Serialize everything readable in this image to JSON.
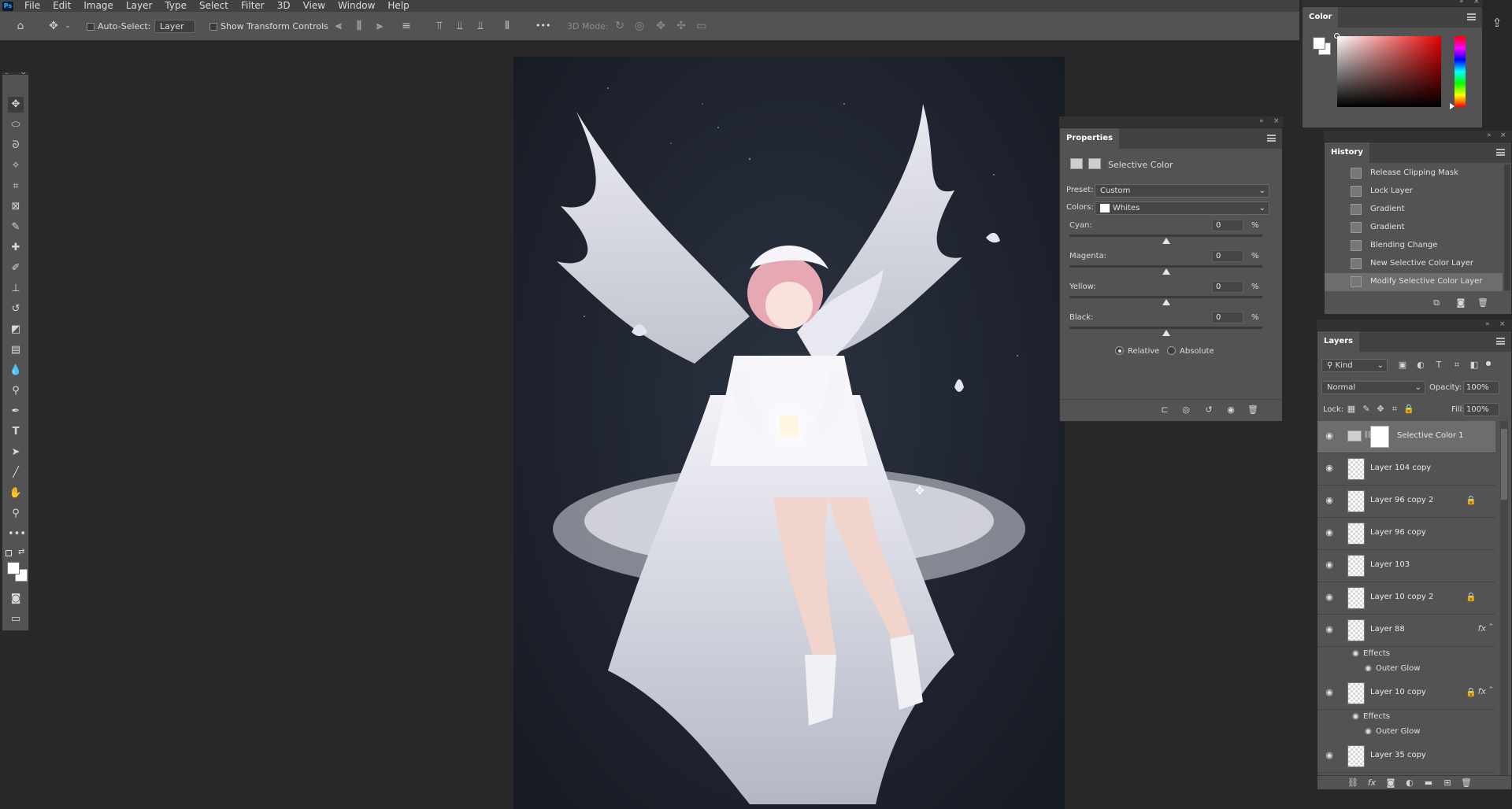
{
  "app": {
    "logo": "Ps"
  },
  "menu": [
    "File",
    "Edit",
    "Image",
    "Layer",
    "Type",
    "Select",
    "Filter",
    "3D",
    "View",
    "Window",
    "Help"
  ],
  "options_bar": {
    "auto_select_label": "Auto-Select:",
    "auto_select_value": "Layer",
    "show_transform_label": "Show Transform Controls",
    "mode_3d_label": "3D Mode:",
    "more_label": "•••"
  },
  "tools": [
    "move-tool",
    "marquee-tool",
    "lasso-tool",
    "magic-wand-tool",
    "crop-tool",
    "frame-tool",
    "eyedropper-tool",
    "healing-brush-tool",
    "brush-tool",
    "clone-stamp-tool",
    "history-brush-tool",
    "eraser-tool",
    "gradient-tool",
    "blur-tool",
    "dodge-tool",
    "pen-tool",
    "type-tool",
    "path-selection-tool",
    "line-tool",
    "hand-tool",
    "zoom-tool"
  ],
  "toolbar_more": "•••",
  "color_panel": {
    "tab": "Color",
    "foreground": "#ffffff",
    "background": "#ffffff"
  },
  "properties": {
    "tab": "Properties",
    "adjustment_name": "Selective Color",
    "preset_label": "Preset:",
    "preset_value": "Custom",
    "colors_label": "Colors:",
    "colors_value": "Whites",
    "sliders": [
      {
        "label": "Cyan:",
        "value": "0",
        "unit": "%",
        "level": 0.5
      },
      {
        "label": "Magenta:",
        "value": "0",
        "unit": "%",
        "level": 0.5
      },
      {
        "label": "Yellow:",
        "value": "0",
        "unit": "%",
        "level": 0.5
      },
      {
        "label": "Black:",
        "value": "0",
        "unit": "%",
        "level": 0.5
      }
    ],
    "method_relative": "Relative",
    "method_absolute": "Absolute",
    "method_selected": "Relative"
  },
  "history": {
    "tab": "History",
    "items": [
      "Release Clipping Mask",
      "Lock Layer",
      "Gradient",
      "Gradient",
      "Blending Change",
      "New Selective Color Layer",
      "Modify Selective Color Layer"
    ]
  },
  "layers": {
    "tab": "Layers",
    "filter_kind": "Kind",
    "blend_mode": "Normal",
    "opacity_label": "Opacity:",
    "opacity_value": "100%",
    "lock_label": "Lock:",
    "fill_label": "Fill:",
    "fill_value": "100%",
    "items": [
      {
        "name": "Selective Color 1",
        "selected": true,
        "adjustment": true
      },
      {
        "name": "Layer 104 copy"
      },
      {
        "name": "Layer 96 copy 2",
        "locked": true
      },
      {
        "name": "Layer 96 copy"
      },
      {
        "name": "Layer 103"
      },
      {
        "name": "Layer 10 copy 2",
        "locked": true
      },
      {
        "name": "Layer 88",
        "fx": true
      },
      {
        "name": "Layer 10 copy",
        "locked": true,
        "fx": true
      },
      {
        "name": "Layer 35 copy"
      }
    ],
    "effects_label": "Effects",
    "outer_glow_label": "Outer Glow",
    "fx_symbol": "fx"
  }
}
